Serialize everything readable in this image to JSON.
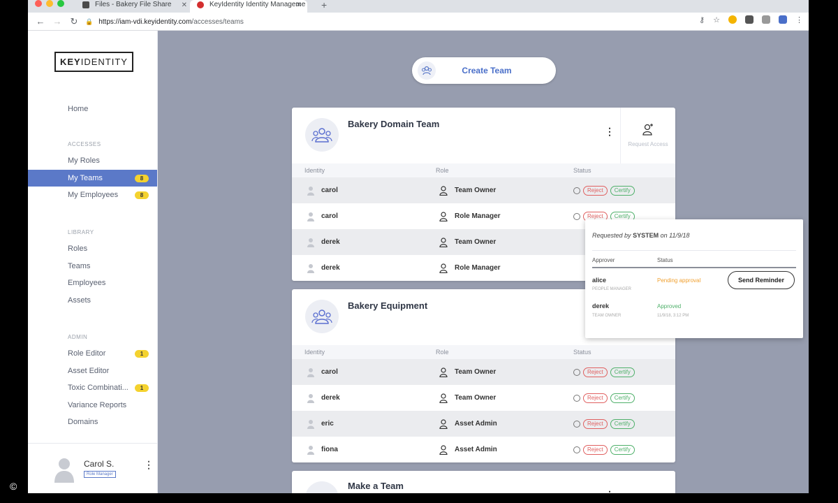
{
  "browser": {
    "tabs": [
      {
        "title": "Files - Bakery File Share",
        "active": false
      },
      {
        "title": "KeyIdentity Identity Manageme",
        "active": true
      }
    ],
    "url_host": "https://iam-vdi.keyidentity.com",
    "url_path": "/accesses/teams"
  },
  "logo": {
    "bold": "KEY",
    "rest": "IDENTITY"
  },
  "sidebar": {
    "home": "Home",
    "sections": [
      {
        "heading": "ACCESSES",
        "items": [
          {
            "label": "My Roles",
            "badge": ""
          },
          {
            "label": "My Teams",
            "badge": "8",
            "active": true
          },
          {
            "label": "My Employees",
            "badge": "8"
          }
        ]
      },
      {
        "heading": "LIBRARY",
        "items": [
          {
            "label": "Roles",
            "badge": ""
          },
          {
            "label": "Teams",
            "badge": ""
          },
          {
            "label": "Employees",
            "badge": ""
          },
          {
            "label": "Assets",
            "badge": ""
          }
        ]
      },
      {
        "heading": "ADMIN",
        "items": [
          {
            "label": "Role Editor",
            "badge": "1"
          },
          {
            "label": "Asset Editor",
            "badge": ""
          },
          {
            "label": "Toxic Combinati...",
            "badge": "1"
          },
          {
            "label": "Variance Reports",
            "badge": ""
          },
          {
            "label": "Domains",
            "badge": ""
          }
        ]
      }
    ],
    "user": {
      "name": "Carol S.",
      "role": "Role Manager"
    }
  },
  "create_team": {
    "label": "Create Team"
  },
  "columns": {
    "identity": "Identity",
    "role": "Role",
    "status": "Status"
  },
  "request_access_label": "Request Access",
  "reject_label": "Reject",
  "certify_label": "Certify",
  "teams": [
    {
      "name": "Bakery Domain Team",
      "rows": [
        {
          "identity": "carol",
          "role": "Team Owner"
        },
        {
          "identity": "carol",
          "role": "Role Manager"
        },
        {
          "identity": "derek",
          "role": "Team Owner"
        },
        {
          "identity": "derek",
          "role": "Role Manager"
        }
      ]
    },
    {
      "name": "Bakery Equipment",
      "rows": [
        {
          "identity": "carol",
          "role": "Team Owner"
        },
        {
          "identity": "derek",
          "role": "Team Owner"
        },
        {
          "identity": "eric",
          "role": "Asset Admin"
        },
        {
          "identity": "fiona",
          "role": "Asset Admin"
        }
      ]
    },
    {
      "name": "Make a Team",
      "rows": []
    }
  ],
  "popover": {
    "requested_prefix": "Requested by",
    "requested_by": "SYSTEM",
    "requested_on": "on 11/9/18",
    "approver_header": "Approver",
    "status_header": "Status",
    "approvers": [
      {
        "name": "alice",
        "title": "PEOPLE MANAGER",
        "status": "Pending approval",
        "status_color": "#f0a030",
        "time": ""
      },
      {
        "name": "derek",
        "title": "TEAM OWNER",
        "status": "Approved",
        "status_color": "#4fb06a",
        "time": "11/9/18, 3:12 PM"
      }
    ],
    "reminder_label": "Send Reminder"
  },
  "copyright": "©"
}
